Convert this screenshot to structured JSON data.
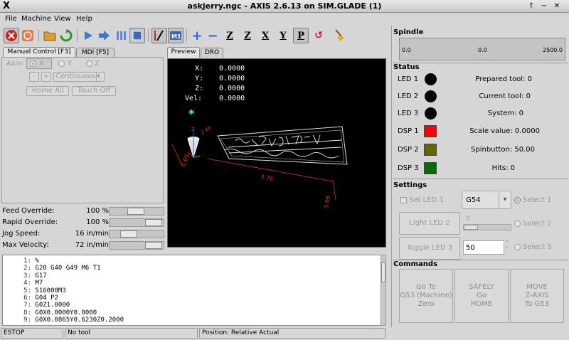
{
  "window": {
    "title": "askjerry.ngc - AXIS 2.6.13 on SIM.GLADE (1)",
    "logo": "X",
    "btn_min": "−",
    "btn_max": "↑",
    "btn_close": "✕"
  },
  "menu": {
    "file": "File",
    "machine": "Machine",
    "view": "View",
    "help": "Help"
  },
  "toolbar": {
    "plus": "+",
    "minus": "−",
    "z": "Z",
    "z2": "Z",
    "x": "X",
    "y": "Y",
    "p": "P",
    "rot": "↺"
  },
  "tabs": {
    "manual": "Manual Control [F3]",
    "mdi": "MDI [F5]",
    "preview": "Preview",
    "dro": "DRO"
  },
  "manual": {
    "axis_label": "Axis:",
    "axis_x": "X",
    "axis_y": "Y",
    "axis_z": "Z",
    "jog_minus": "-",
    "jog_plus": "+",
    "jog_mode": "Continuous",
    "dropdown_arrow": "▾",
    "home_all": "Home All",
    "touch_off": "Touch Off"
  },
  "overrides": {
    "feed": {
      "name": "Feed Override:",
      "value": "100 %",
      "level": 0.5
    },
    "rapid": {
      "name": "Rapid Override:",
      "value": "100 %",
      "level": 1.0
    },
    "jog": {
      "name": "Jog Speed:",
      "value": "16 in/min",
      "level": 0.3
    },
    "maxvel": {
      "name": "Max Velocity:",
      "value": "72 in/min",
      "level": 1.0
    }
  },
  "dro": {
    "x_label": "X:",
    "x_val": "0.0000",
    "y_label": "Y:",
    "y_val": "0.0000",
    "z_label": "Z:",
    "z_val": "0.0000",
    "vel_label": "Vel:",
    "vel_val": "0.0000",
    "dims": {
      "a": "3.76",
      "b": "5.66",
      "c": "0.65",
      "d": "2.46"
    }
  },
  "gcode": [
    {
      "n": "1:",
      "text": "%"
    },
    {
      "n": "2:",
      "text": "G20 G40 G49 M6 T1"
    },
    {
      "n": "3:",
      "text": "G17"
    },
    {
      "n": "4:",
      "text": "M7"
    },
    {
      "n": "5:",
      "text": "S16000M3"
    },
    {
      "n": "6:",
      "text": "G04 P2"
    },
    {
      "n": "7:",
      "text": "G0Z1.0000"
    },
    {
      "n": "8:",
      "text": "G0X0.0000Y0.0000"
    },
    {
      "n": "9:",
      "text": "G0X0.0865Y0.6230Z0.2000"
    }
  ],
  "statusbar": {
    "estop": "ESTOP",
    "tool": "No tool",
    "position": "Position: Relative Actual"
  },
  "spindle": {
    "title": "Spindle",
    "min": "0.0",
    "mid": "0.0",
    "max": "2500.0"
  },
  "status": {
    "title": "Status",
    "led1": "LED 1",
    "led2": "LED 2",
    "led3": "LED 3",
    "dsp1": "DSP 1",
    "dsp2": "DSP 2",
    "dsp3": "DSP 3",
    "prepared": "Prepared tool: 0",
    "current": "Current tool: 0",
    "system": "System: 0",
    "scale": "Scale value: 0.0000",
    "spin": "Spinbutton: 50.00",
    "hits": "Hits: 0",
    "colors": {
      "dsp1": "#ff0000",
      "dsp2": "#6b6300",
      "dsp3": "#006b00"
    }
  },
  "settings": {
    "title": "Settings",
    "set_led1": "Set LED 1",
    "combo": "G54",
    "combo_arrow": "▾",
    "select1": "Select 1",
    "select2": "Select 2",
    "select3": "Select 3",
    "light_led2": "Light LED 2",
    "toggle_led3": "Toggle LED 3",
    "scale_value": "0",
    "scale_level": 0.0,
    "spin_value": "50",
    "spin_up": "˄",
    "spin_down": "˅"
  },
  "commands": {
    "title": "Commands",
    "goto": "Go To\nG53 (Machine)\nZero",
    "home": "SAFELY\nGo\nHOME",
    "move": "MOVE\nZ-AXIS\nTo G53"
  }
}
